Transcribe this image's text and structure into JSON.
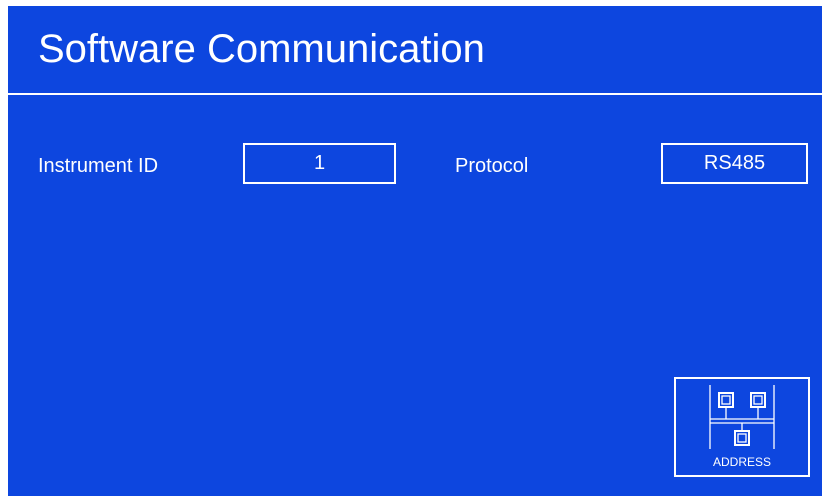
{
  "header": {
    "title": "Software Communication"
  },
  "settings": {
    "instrument_id_label": "Instrument ID",
    "instrument_id_value": "1",
    "protocol_label": "Protocol",
    "protocol_value": "RS485"
  },
  "actions": {
    "address_button_label": "ADDRESS",
    "address_icon": "network-nodes-icon"
  },
  "colors": {
    "background": "#0d46df",
    "foreground": "#ffffff"
  }
}
